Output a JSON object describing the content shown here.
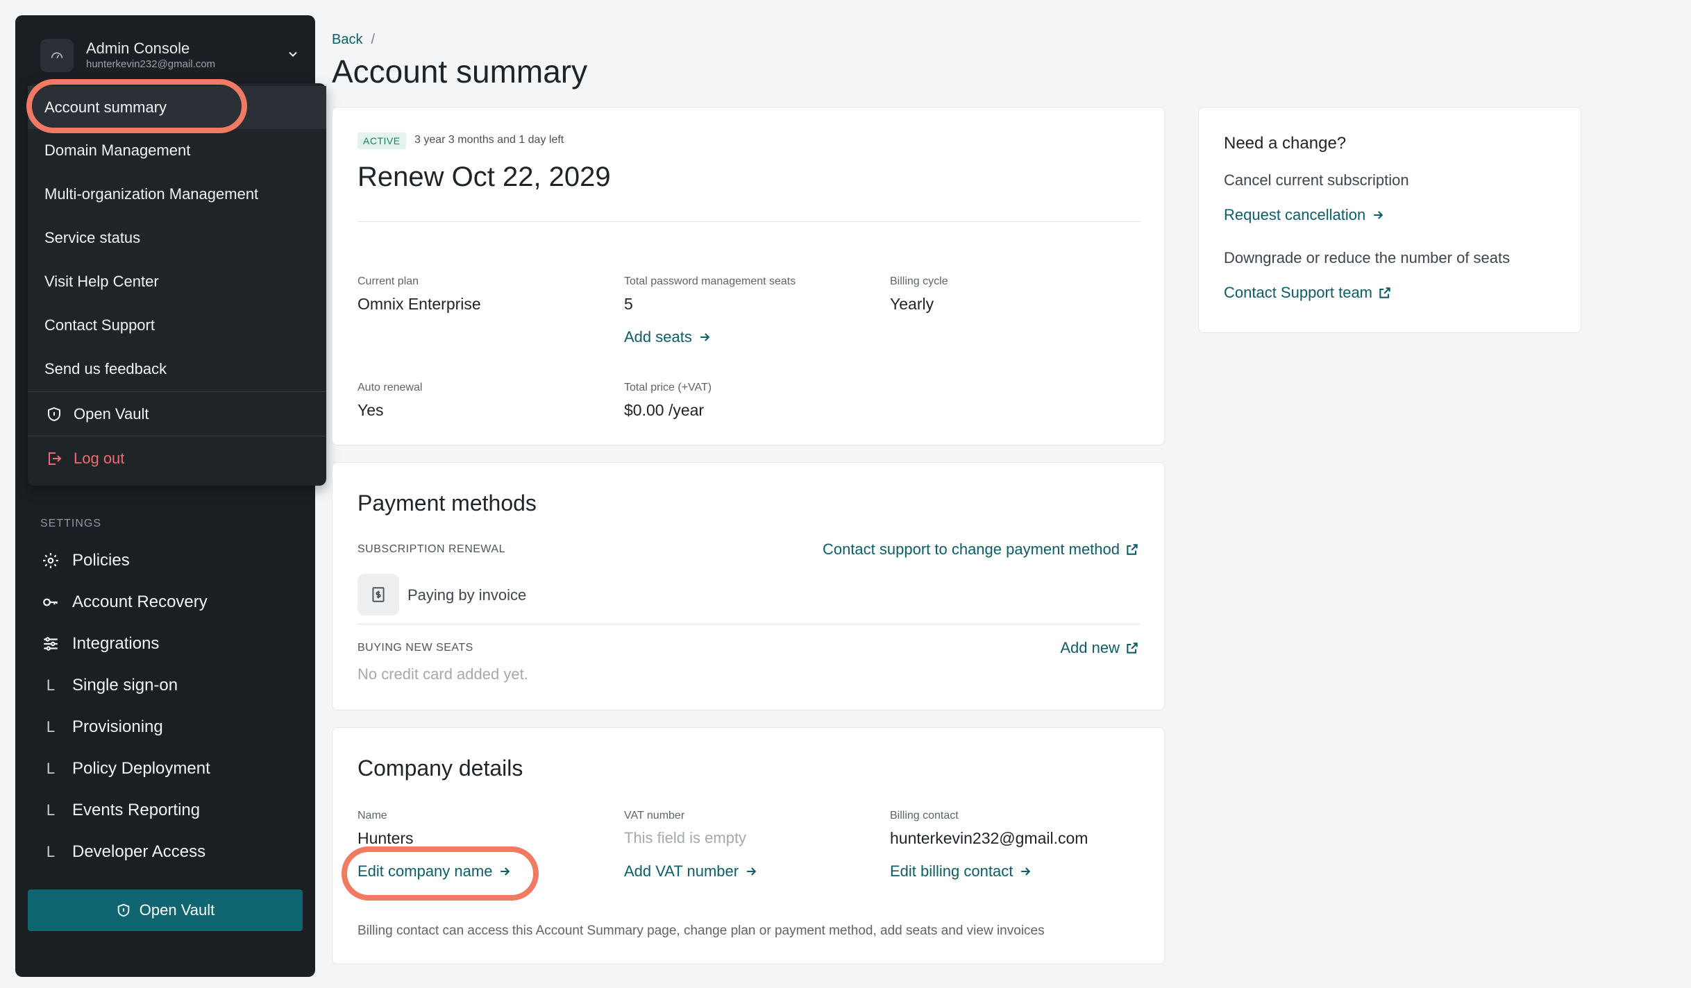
{
  "console": {
    "title": "Admin Console",
    "email": "hunterkevin232@gmail.com"
  },
  "dropdown": {
    "items": [
      {
        "label": "Account summary"
      },
      {
        "label": "Domain Management"
      },
      {
        "label": "Multi-organization Management"
      },
      {
        "label": "Service status"
      },
      {
        "label": "Visit Help Center"
      },
      {
        "label": "Contact Support"
      },
      {
        "label": "Send us feedback"
      }
    ],
    "open_vault": "Open Vault",
    "logout": "Log out"
  },
  "sidebar": {
    "settings_label": "SETTINGS",
    "items": [
      {
        "label": "Policies",
        "icon": "gear-icon"
      },
      {
        "label": "Account Recovery",
        "icon": "key-icon"
      },
      {
        "label": "Integrations",
        "icon": "sliders-icon"
      },
      {
        "label": "Single sign-on",
        "icon": "sub-item-icon"
      },
      {
        "label": "Provisioning",
        "icon": "sub-item-icon"
      },
      {
        "label": "Policy Deployment",
        "icon": "sub-item-icon"
      },
      {
        "label": "Events Reporting",
        "icon": "sub-item-icon"
      },
      {
        "label": "Developer Access",
        "icon": "sub-item-icon"
      }
    ],
    "sub_glyph": "L",
    "open_vault_button": "Open Vault"
  },
  "breadcrumb": {
    "back": "Back",
    "separator": "/"
  },
  "page_title": "Account summary",
  "subscription": {
    "status": "ACTIVE",
    "time_left": "3 year 3 months and 1 day left",
    "renew": "Renew Oct 22, 2029",
    "current_plan_label": "Current plan",
    "current_plan": "Omnix Enterprise",
    "seats_label": "Total password management seats",
    "seats": "5",
    "add_seats": "Add seats",
    "billing_cycle_label": "Billing cycle",
    "billing_cycle": "Yearly",
    "auto_renewal_label": "Auto renewal",
    "auto_renewal": "Yes",
    "total_price_label": "Total price (+VAT)",
    "total_price": "$0.00 /year"
  },
  "payment": {
    "title": "Payment methods",
    "renewal_label": "SUBSCRIPTION RENEWAL",
    "contact_link": "Contact support to change payment method",
    "method": "Paying by invoice",
    "buying_label": "BUYING NEW SEATS",
    "add_new": "Add new",
    "no_card": "No credit card added yet."
  },
  "company": {
    "title": "Company details",
    "name_label": "Name",
    "name": "Hunters",
    "edit_name": "Edit company name",
    "vat_label": "VAT number",
    "vat_empty": "This field is empty",
    "add_vat": "Add VAT number",
    "billing_label": "Billing contact",
    "billing_email": "hunterkevin232@gmail.com",
    "edit_billing": "Edit billing contact",
    "note": "Billing contact can access this Account Summary page, change plan or payment method, add seats and view invoices"
  },
  "side_panel": {
    "title": "Need a change?",
    "cancel_text": "Cancel current subscription",
    "request_cancel": "Request cancellation",
    "downgrade_text": "Downgrade or reduce the number of seats",
    "contact_team": "Contact Support team"
  },
  "colors": {
    "accent": "#0d5c66",
    "sidebar_bg": "#1b1f23",
    "highlight": "#f07a62",
    "logout": "#f06b6b"
  }
}
